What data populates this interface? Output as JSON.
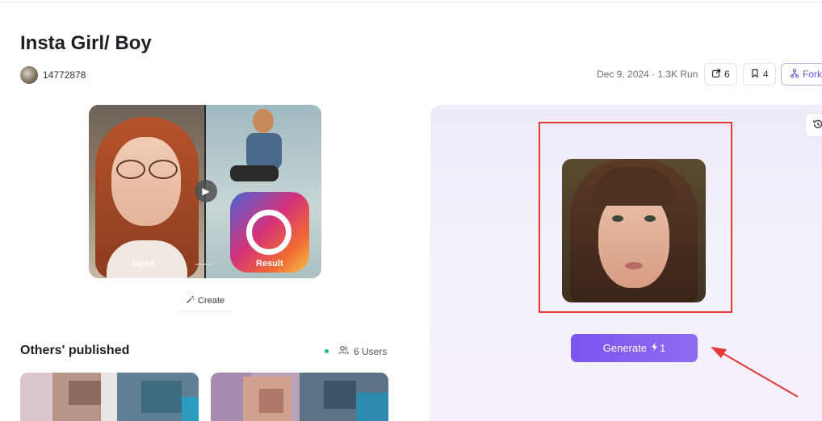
{
  "page": {
    "title": "Insta Girl/ Boy",
    "author": "14772878",
    "meta": "Dec 9, 2024 · 1.3K Run",
    "share_count": "6",
    "bookmark_count": "4",
    "fork_label": "Fork"
  },
  "demo": {
    "input_label": "Input",
    "result_label": "Result"
  },
  "create_label": "Create",
  "others": {
    "title": "Others' published",
    "users": "6 Users"
  },
  "generate": {
    "label": "Generate",
    "cost": "1"
  },
  "colors": {
    "accent": "#7b55ef",
    "annotation": "#e53935",
    "online_dot": "#20b486"
  },
  "icons": [
    "share-icon",
    "bookmark-icon",
    "fork-icon",
    "history-icon",
    "play-icon",
    "wand-icon",
    "users-icon",
    "bolt-icon"
  ]
}
